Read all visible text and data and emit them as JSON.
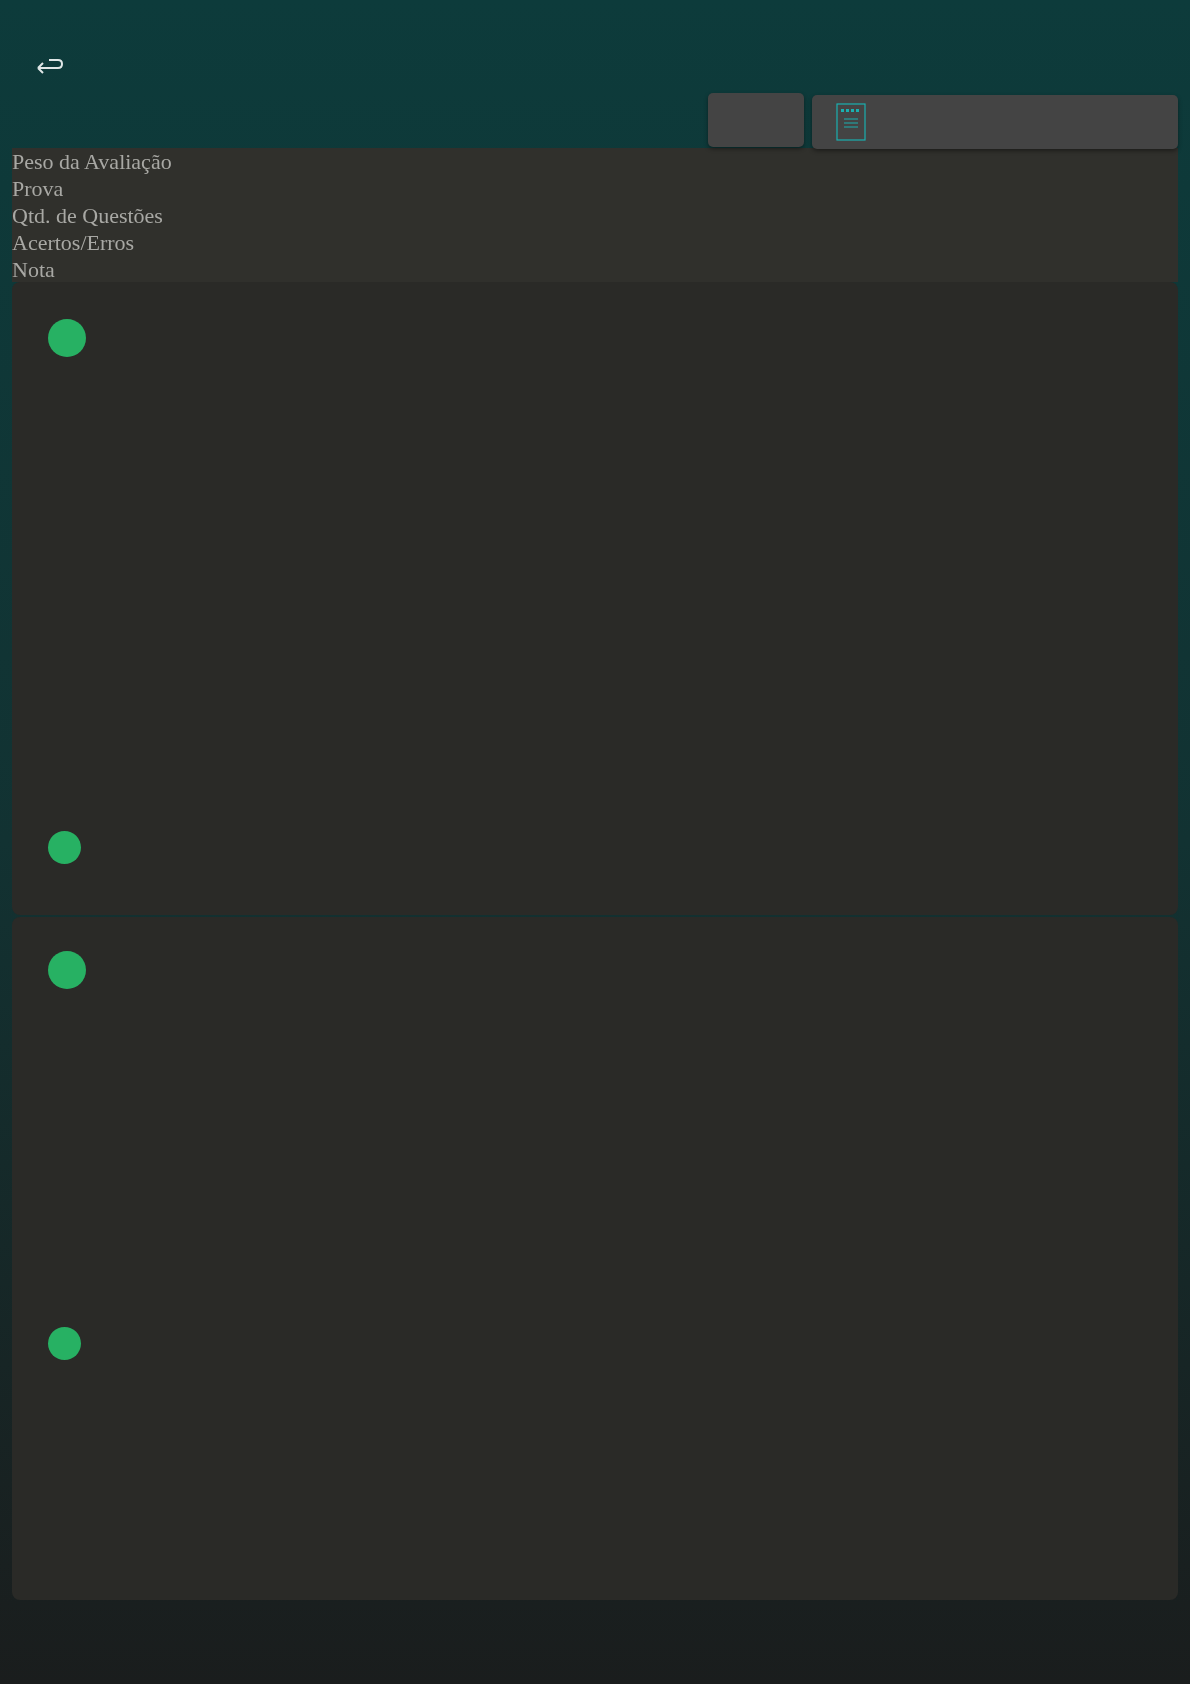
{
  "header_labels": [
    "Peso da Avaliação",
    "Prova",
    "Qtd. de Questões",
    "Acertos/Erros",
    "Nota"
  ],
  "cards": [
    {
      "kind": "question"
    },
    {
      "kind": "question"
    }
  ]
}
